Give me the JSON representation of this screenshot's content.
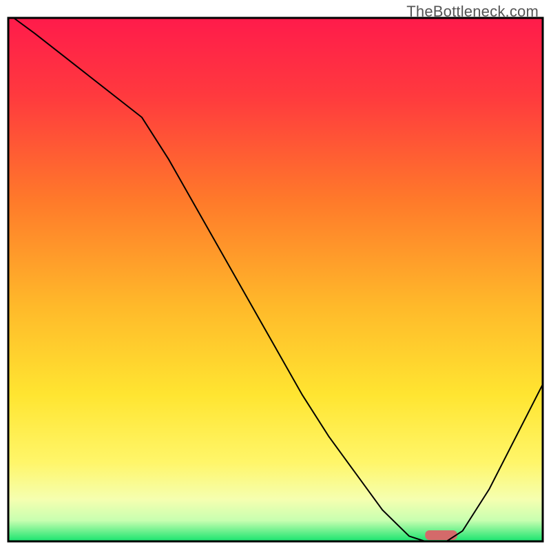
{
  "watermark": "TheBottleneck.com",
  "chart_data": {
    "type": "line",
    "title": "",
    "xlabel": "",
    "ylabel": "",
    "xlim": [
      0,
      100
    ],
    "ylim": [
      0,
      100
    ],
    "series": [
      {
        "name": "bottleneck-curve",
        "x": [
          1,
          5,
          10,
          15,
          20,
          25,
          30,
          35,
          40,
          45,
          50,
          55,
          60,
          65,
          70,
          75,
          78,
          82,
          85,
          90,
          95,
          100
        ],
        "values": [
          100,
          97,
          93,
          89,
          85,
          81,
          73,
          64,
          55,
          46,
          37,
          28,
          20,
          13,
          6,
          1,
          0,
          0,
          2,
          10,
          20,
          30
        ]
      }
    ],
    "marker": {
      "name": "highlight-bar",
      "x_start": 78,
      "x_end": 84,
      "color": "#d46a6a"
    },
    "gradient_stops": [
      {
        "offset": 0,
        "color": "#ff1b4b"
      },
      {
        "offset": 15,
        "color": "#ff3a3e"
      },
      {
        "offset": 35,
        "color": "#ff7a2a"
      },
      {
        "offset": 55,
        "color": "#ffb92a"
      },
      {
        "offset": 72,
        "color": "#ffe531"
      },
      {
        "offset": 85,
        "color": "#fff66a"
      },
      {
        "offset": 92,
        "color": "#f5ffb0"
      },
      {
        "offset": 96,
        "color": "#c8ffb0"
      },
      {
        "offset": 100,
        "color": "#17e36e"
      }
    ],
    "frame_color": "#000000",
    "frame_width": 3,
    "line_color": "#000000",
    "line_width": 2
  }
}
